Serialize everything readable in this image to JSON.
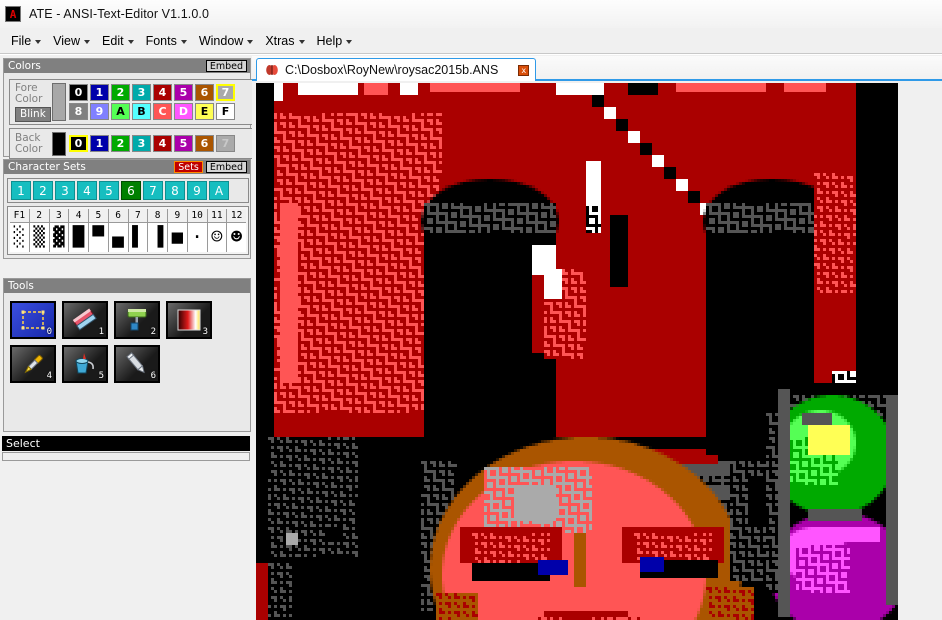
{
  "window": {
    "title": "ATE - ANSI-Text-Editor V1.1.0.0",
    "icon": "app-logo-icon"
  },
  "menubar": {
    "items": [
      {
        "label": "File"
      },
      {
        "label": "View"
      },
      {
        "label": "Edit"
      },
      {
        "label": "Fonts"
      },
      {
        "label": "Window"
      },
      {
        "label": "Xtras"
      },
      {
        "label": "Help"
      }
    ]
  },
  "colors_panel": {
    "header": "Colors",
    "embed_label": "Embed",
    "fore": {
      "label_line1": "Fore",
      "label_line2": "Color",
      "blink_label": "Blink",
      "current_color": "#a8a8a8",
      "selected_index": 7,
      "row1": [
        {
          "label": "0",
          "color": "#000000",
          "text": "#ffffff"
        },
        {
          "label": "1",
          "color": "#0000aa",
          "text": "#ffffff"
        },
        {
          "label": "2",
          "color": "#00aa00",
          "text": "#ffffff"
        },
        {
          "label": "3",
          "color": "#00aaaa",
          "text": "#ffffff"
        },
        {
          "label": "4",
          "color": "#aa0000",
          "text": "#ffffff"
        },
        {
          "label": "5",
          "color": "#aa00aa",
          "text": "#ffffff"
        },
        {
          "label": "6",
          "color": "#aa5500",
          "text": "#ffffff"
        },
        {
          "label": "7",
          "color": "#aaaaaa",
          "text": "#ffffff"
        }
      ],
      "row2": [
        {
          "label": "8",
          "color": "#808080",
          "text": "#ffffff"
        },
        {
          "label": "9",
          "color": "#8080ff",
          "text": "#ffffff"
        },
        {
          "label": "A",
          "color": "#55ff55",
          "text": "#000000"
        },
        {
          "label": "B",
          "color": "#55ffff",
          "text": "#000000"
        },
        {
          "label": "C",
          "color": "#ff5555",
          "text": "#ffffff"
        },
        {
          "label": "D",
          "color": "#ff55ff",
          "text": "#ffffff"
        },
        {
          "label": "E",
          "color": "#ffff55",
          "text": "#000000"
        },
        {
          "label": "F",
          "color": "#ffffff",
          "text": "#000000"
        }
      ]
    },
    "back": {
      "label_line1": "Back",
      "label_line2": "Color",
      "current_color": "#000000",
      "selected_index": 0,
      "row1": [
        {
          "label": "0",
          "color": "#000000",
          "text": "#ffffff"
        },
        {
          "label": "1",
          "color": "#0000aa",
          "text": "#ffffff"
        },
        {
          "label": "2",
          "color": "#00aa00",
          "text": "#ffffff"
        },
        {
          "label": "3",
          "color": "#00aaaa",
          "text": "#ffffff"
        },
        {
          "label": "4",
          "color": "#aa0000",
          "text": "#ffffff"
        },
        {
          "label": "5",
          "color": "#aa00aa",
          "text": "#ffffff"
        },
        {
          "label": "6",
          "color": "#aa5500",
          "text": "#ffffff"
        },
        {
          "label": "7",
          "color": "#aaaaaa",
          "text": "#c8c8c8"
        }
      ]
    }
  },
  "charsets_panel": {
    "header": "Character Sets",
    "sets_label": "Sets",
    "embed_label": "Embed",
    "set_buttons": [
      "1",
      "2",
      "3",
      "4",
      "5",
      "6",
      "7",
      "8",
      "9",
      "A"
    ],
    "active_set": "6",
    "fkeys": [
      {
        "label": "F1",
        "glyph": "░"
      },
      {
        "label": "2",
        "glyph": "▒"
      },
      {
        "label": "3",
        "glyph": "▓"
      },
      {
        "label": "4",
        "glyph": "█"
      },
      {
        "label": "5",
        "glyph": "▀"
      },
      {
        "label": "6",
        "glyph": "▄"
      },
      {
        "label": "7",
        "glyph": "▌"
      },
      {
        "label": "8",
        "glyph": "▐"
      },
      {
        "label": "9",
        "glyph": "■"
      },
      {
        "label": "10",
        "glyph": "·"
      },
      {
        "label": "11",
        "glyph": "☺"
      },
      {
        "label": "12",
        "glyph": "☻"
      }
    ]
  },
  "tools_panel": {
    "header": "Tools",
    "status": "Select",
    "tools": [
      {
        "num": "0",
        "name": "select-tool",
        "icon": "marquee-select-icon",
        "active": true
      },
      {
        "num": "1",
        "name": "eraser-tool",
        "icon": "eraser-icon",
        "active": false
      },
      {
        "num": "2",
        "name": "roller-tool",
        "icon": "paint-roller-icon",
        "active": false
      },
      {
        "num": "3",
        "name": "gradient-tool",
        "icon": "gradient-icon",
        "active": false
      },
      {
        "num": "4",
        "name": "eyedropper-tool",
        "icon": "eyedropper-icon",
        "active": false
      },
      {
        "num": "5",
        "name": "fill-tool",
        "icon": "paint-bucket-icon",
        "active": false
      },
      {
        "num": "6",
        "name": "pencil-tool",
        "icon": "pencil-icon",
        "active": false
      }
    ]
  },
  "document": {
    "tab_title": "C:\\Dosbox\\RoyNew\\roysac2015b.ANS",
    "tab_icon": "ansi-doc-icon",
    "close_label": "x",
    "canvas_bg": "#000000"
  }
}
